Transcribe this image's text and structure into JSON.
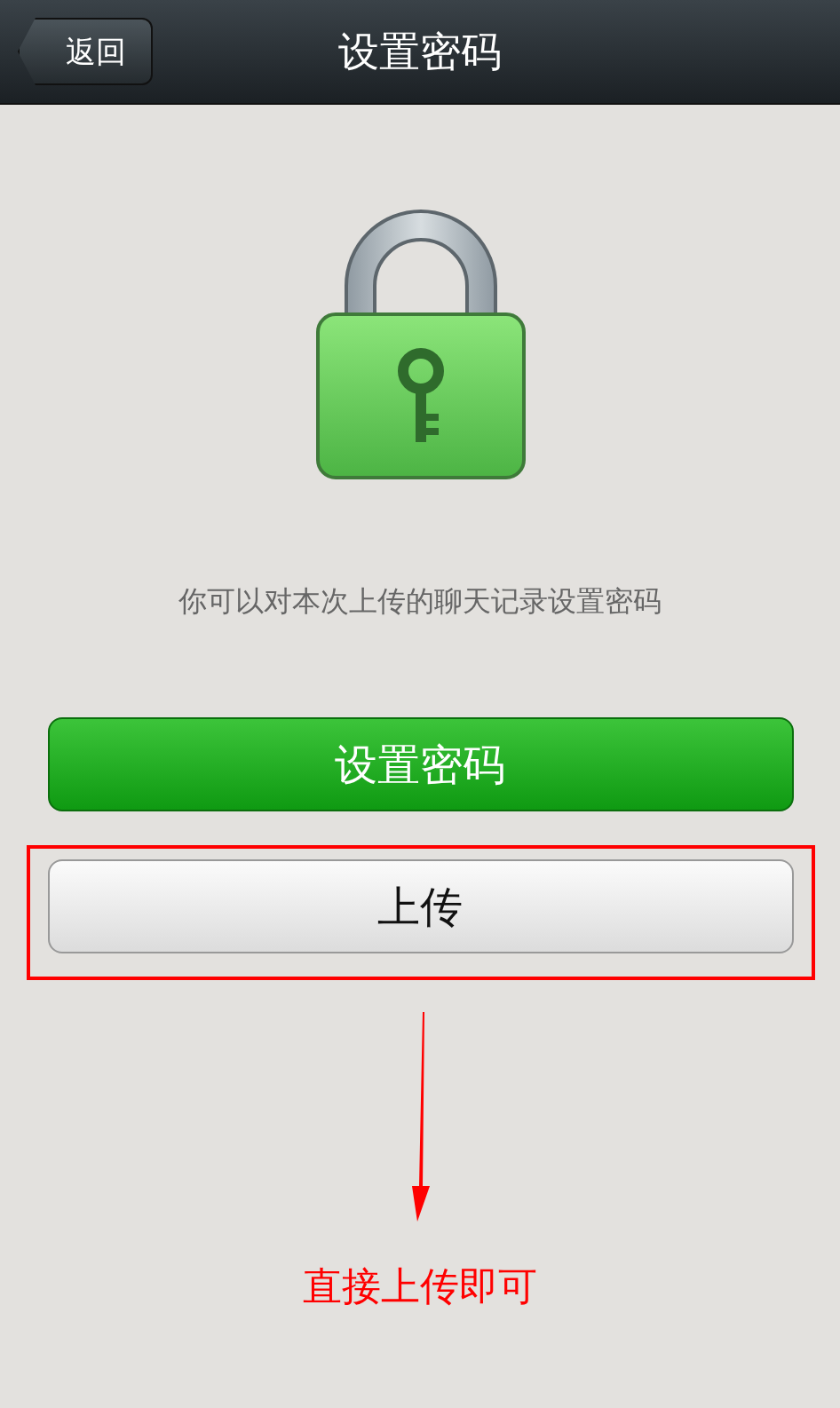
{
  "nav_bar": {
    "back_button": "返回",
    "title": "设置密码"
  },
  "hint": "你可以对本次上传的聊天记录设置密码",
  "buttons": [
    {
      "label": "设置密码",
      "kind": "primary",
      "highlighted": false
    },
    {
      "label": "上传",
      "kind": "secondary",
      "highlighted": true
    }
  ],
  "annotation": {
    "text": "直接上传即可"
  }
}
